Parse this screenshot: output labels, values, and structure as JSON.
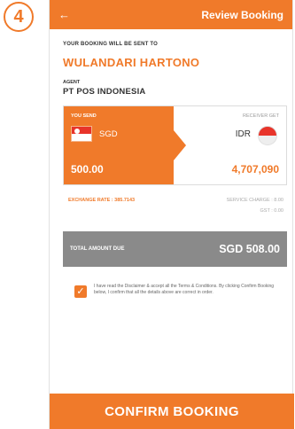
{
  "step_badge": "4",
  "header": {
    "title": "Review Booking",
    "back_icon": "arrow-left-icon"
  },
  "booking": {
    "sent_to_label": "YOUR BOOKING WILL BE SENT TO",
    "recipient_name": "WULANDARI HARTONO",
    "agent_label": "AGENT",
    "agent_value": "PT POS INDONESIA"
  },
  "exchange": {
    "send_label": "YOU SEND",
    "send_currency": "SGD",
    "send_amount": "500.00",
    "receive_label": "RECEIVER GET",
    "receive_currency": "IDR",
    "receive_amount": "4,707,090",
    "rate_text": "EXCHANGE RATE : 385.7143",
    "service_charge_text": "SERVICE CHARGE : 8.00",
    "gst_text": "GST : 0.00"
  },
  "total": {
    "label": "TOTAL AMOUNT DUE",
    "value": "SGD 508.00"
  },
  "agreement": {
    "checked": true,
    "text": "I have read the Disclaimer & accept all the Terms & Conditions. By clicking Confirm Booking below, I confirm that all the details above are correct in order."
  },
  "confirm_label": "CONFIRM BOOKING",
  "colors": {
    "accent": "#f07a2a",
    "total_bar": "#8a8a8a"
  }
}
